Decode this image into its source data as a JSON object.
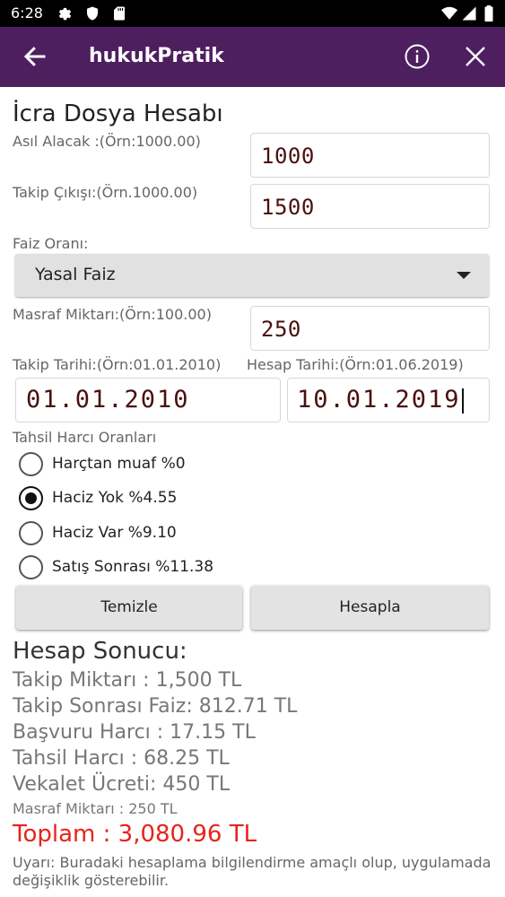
{
  "status": {
    "time": "6:28"
  },
  "appbar": {
    "title": "hukukPratik"
  },
  "form": {
    "title": "İcra Dosya Hesabı",
    "asil_alacak": {
      "label": "Asıl Alacak :(Örn:1000.00)",
      "value": "1000"
    },
    "takip_cikisi": {
      "label": "Takip Çıkışı:(Örn.1000.00)",
      "value": "1500"
    },
    "faiz": {
      "label": "Faiz Oranı:",
      "selected": "Yasal Faiz"
    },
    "masraf": {
      "label": "Masraf Miktarı:(Örn:100.00)",
      "value": "250"
    },
    "takip_tarihi": {
      "label": "Takip Tarihi:(Örn:01.01.2010)",
      "value": "01.01.2010"
    },
    "hesap_tarihi": {
      "label": "Hesap Tarihi:(Örn:01.06.2019)",
      "value": "10.01.2019"
    },
    "harc": {
      "label": "Tahsil Harcı Oranları",
      "options": [
        {
          "label": "Harçtan muaf %0",
          "checked": false
        },
        {
          "label": "Haciz Yok %4.55",
          "checked": true
        },
        {
          "label": "Haciz Var %9.10",
          "checked": false
        },
        {
          "label": "Satış Sonrası %11.38",
          "checked": false
        }
      ]
    },
    "buttons": {
      "clear": "Temizle",
      "calculate": "Hesapla"
    }
  },
  "result": {
    "title": "Hesap Sonucu:",
    "lines": [
      "Takip Miktarı : 1,500 TL",
      "Takip Sonrası Faiz: 812.71 TL",
      "Başvuru Harcı : 17.15 TL",
      "Tahsil Harcı : 68.25 TL",
      "Vekalet Ücreti: 450 TL"
    ],
    "masraf": "Masraf Miktarı : 250 TL",
    "total": "Toplam : 3,080.96 TL",
    "warning": "Uyarı: Buradaki hesaplama bilgilendirme amaçlı olup, uygulamada değişiklik gösterebilir."
  },
  "colors": {
    "appbar": "#4e1f5f",
    "total": "#e8231b",
    "field_text": "#4a1010"
  }
}
